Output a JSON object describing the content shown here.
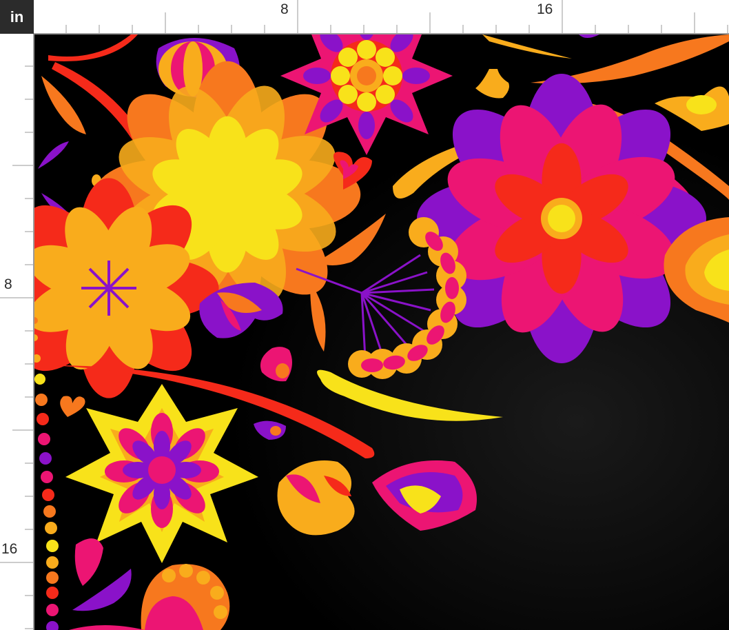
{
  "ruler": {
    "unit": "in",
    "top_labels": [
      "8",
      "16"
    ],
    "left_labels": [
      "8",
      "16"
    ]
  },
  "fabric": {
    "background": "#000000",
    "palette": [
      "#8a12c9",
      "#ec1573",
      "#f52a1a",
      "#f7781e",
      "#f9ac1c",
      "#f8e21a"
    ]
  }
}
